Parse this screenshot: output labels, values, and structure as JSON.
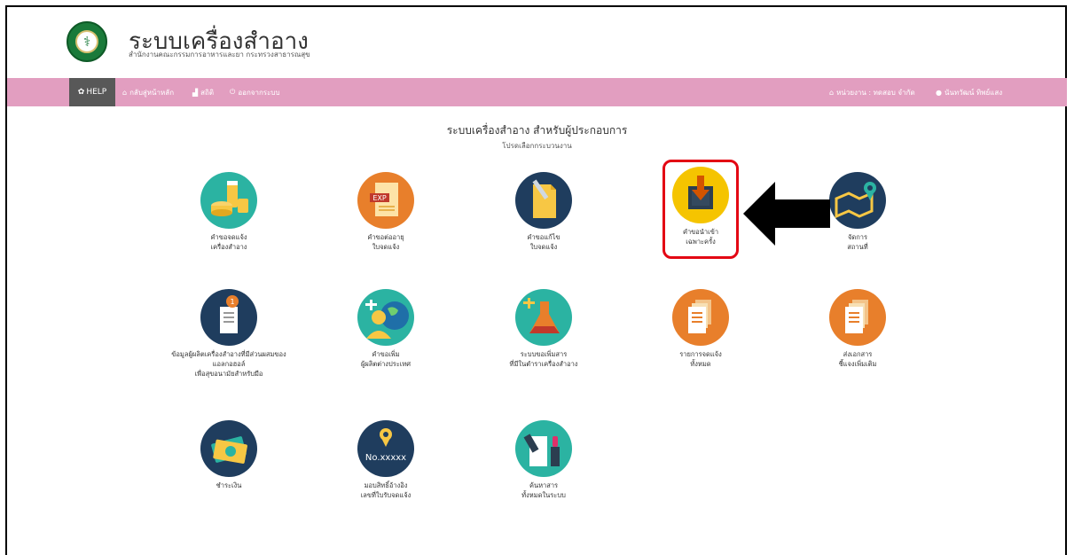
{
  "header": {
    "title": "ระบบเครื่องสำอาง",
    "subtitle": "สำนักงานคณะกรรมการอาหารและยา กระทรวงสาธารณสุข"
  },
  "nav": {
    "help": "HELP",
    "home": "กลับสู่หน้าหลัก",
    "stats": "สถิติ",
    "logout": "ออกจากระบบ",
    "agency": "หน่วยงาน : ทดสอบ จำกัด",
    "user": "นันทวัฒน์ ทิพย์แสง"
  },
  "main": {
    "title": "ระบบเครื่องสำอาง สำหรับผู้ประกอบการ",
    "subtitle": "โปรดเลือกกระบวนงาน"
  },
  "tiles": [
    {
      "line1": "คำขอจดแจ้ง",
      "line2": "เครื่องสำอาง",
      "line3": ""
    },
    {
      "line1": "คำขอต่ออายุ",
      "line2": "ใบจดแจ้ง",
      "line3": ""
    },
    {
      "line1": "คำขอแก้ไข",
      "line2": "ใบจดแจ้ง",
      "line3": ""
    },
    {
      "line1": "คำขอนำเข้า",
      "line2": "เฉพาะครั้ง",
      "line3": ""
    },
    {
      "line1": "จัดการ",
      "line2": "สถานที่",
      "line3": ""
    },
    {
      "line1": "ข้อมูลผู้ผลิตเครื่องสำอางที่มีส่วนผสมของ",
      "line2": "แอลกอฮอล์",
      "line3": "เพื่อสุขอนามัยสำหรับมือ"
    },
    {
      "line1": "คำขอเพิ่ม",
      "line2": "ผู้ผลิตต่างประเทศ",
      "line3": ""
    },
    {
      "line1": "ระบบขอเพิ่มสาร",
      "line2": "ที่มีในตำราเครื่องสำอาง",
      "line3": ""
    },
    {
      "line1": "รายการจดแจ้ง",
      "line2": "ทั้งหมด",
      "line3": ""
    },
    {
      "line1": "ส่งเอกสาร",
      "line2": "ชี้แจงเพิ่มเติม",
      "line3": ""
    },
    {
      "line1": "ชำระเงิน",
      "line2": "",
      "line3": ""
    },
    {
      "line1": "มอบสิทธิ์อ้างอิง",
      "line2": "เลขที่ใบรับจดแจ้ง",
      "line3": ""
    },
    {
      "line1": "ค้นหาสาร",
      "line2": "ทั้งหมดในระบบ",
      "line3": ""
    }
  ],
  "icon_texts": {
    "exp": "EXP",
    "no": "No.xxxxx",
    "pin_number": "1"
  },
  "colors": {
    "navbar": "#e29ec0",
    "help_bg": "#585858",
    "highlight": "#e30613",
    "teal": "#2bb3a2",
    "navy": "#1f3d5e",
    "orange": "#e87f2b",
    "yellow": "#f5c400"
  }
}
